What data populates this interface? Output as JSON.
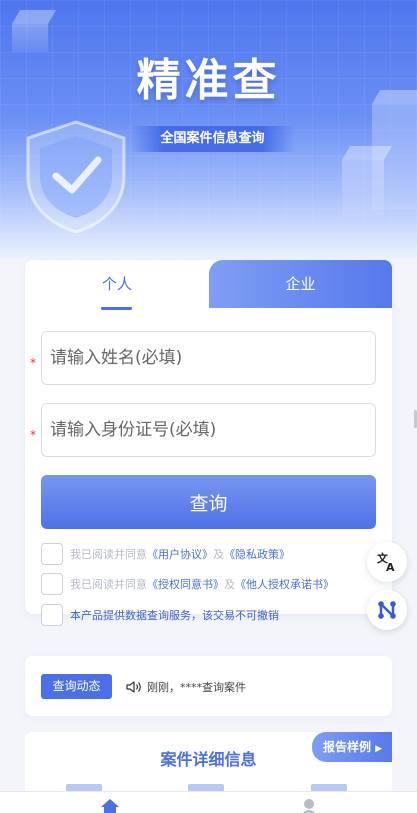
{
  "hero": {
    "title": "精准查",
    "subtitle": "全国案件信息查询"
  },
  "tabs": [
    {
      "label": "个人",
      "active": true
    },
    {
      "label": "企业",
      "active": false
    }
  ],
  "form": {
    "required_mark": "*",
    "name_placeholder": "请输入姓名(必填)",
    "id_placeholder": "请输入身份证号(必填)",
    "query_label": "查询"
  },
  "agreements": [
    {
      "prefix": "我已阅读并同意",
      "link1": "《用户协议》",
      "conj": "及",
      "link2": "《隐私政策》"
    },
    {
      "prefix": "我已阅读并同意",
      "link1": "《授权同意书》",
      "conj": "及",
      "link2": "《他人授权承诺书》"
    },
    {
      "text": "本产品提供数据查询服务，该交易不可撤销"
    }
  ],
  "side_buttons": [
    {
      "icon": "translate-icon"
    },
    {
      "icon": "share-node-icon"
    }
  ],
  "activity": {
    "badge": "查询动态",
    "message": "刚刚，****查询案件"
  },
  "details": {
    "title": "案件详细信息",
    "sample_button": "报告样例"
  },
  "bottom_nav": [
    {
      "icon": "home-icon",
      "active": true
    },
    {
      "icon": "user-icon",
      "active": false
    }
  ],
  "colors": {
    "accent": "#4a6fe6",
    "required": "#ee3344",
    "hero_top": "#4f76ee"
  }
}
